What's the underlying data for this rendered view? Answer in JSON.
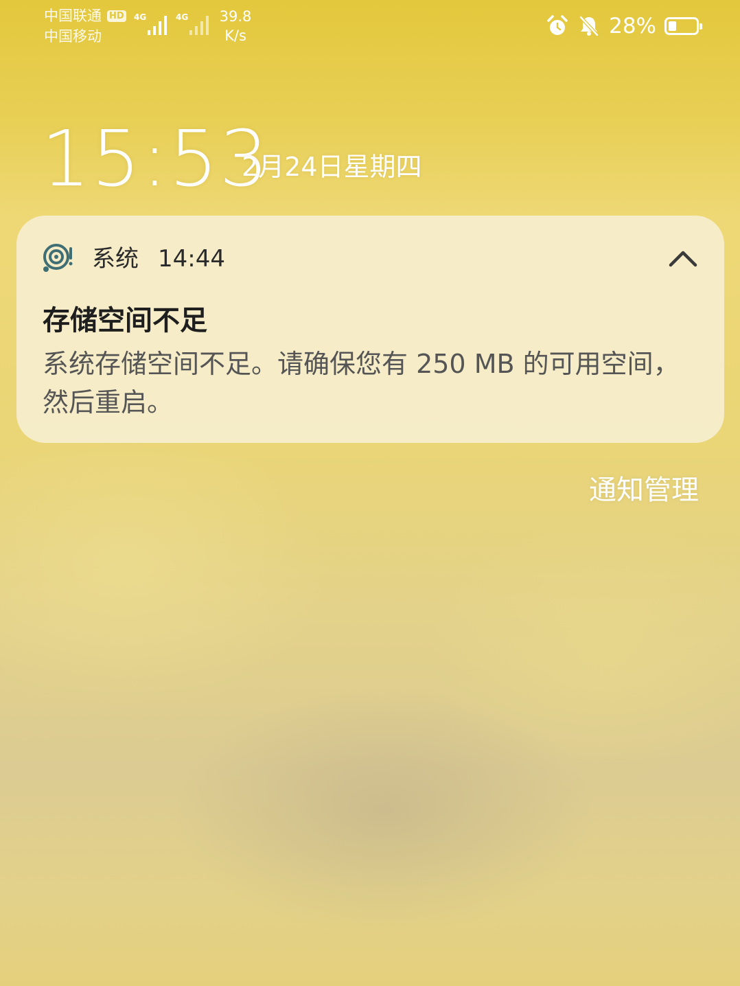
{
  "status_bar": {
    "carrier_1": "中国联通",
    "hd_badge": "HD",
    "carrier_2": "中国移动",
    "signal_1_type": "4G",
    "signal_2_type": "4G",
    "speed_value": "39.8",
    "speed_unit": "K/s",
    "battery_percent": "28%",
    "battery_level": 0.28
  },
  "lockscreen": {
    "time": "15:53",
    "date": "2月24日星期四"
  },
  "notification": {
    "app_name": "系统",
    "time": "14:44",
    "title": "存储空间不足",
    "body": "系统存储空间不足。请确保您有 250 MB 的可用空间，然后重启。"
  },
  "notification_manage": "通知管理",
  "colors": {
    "background_top": "#e3c83c",
    "card_bg": "#f8f2da",
    "icon_teal": "#3f6f75"
  }
}
